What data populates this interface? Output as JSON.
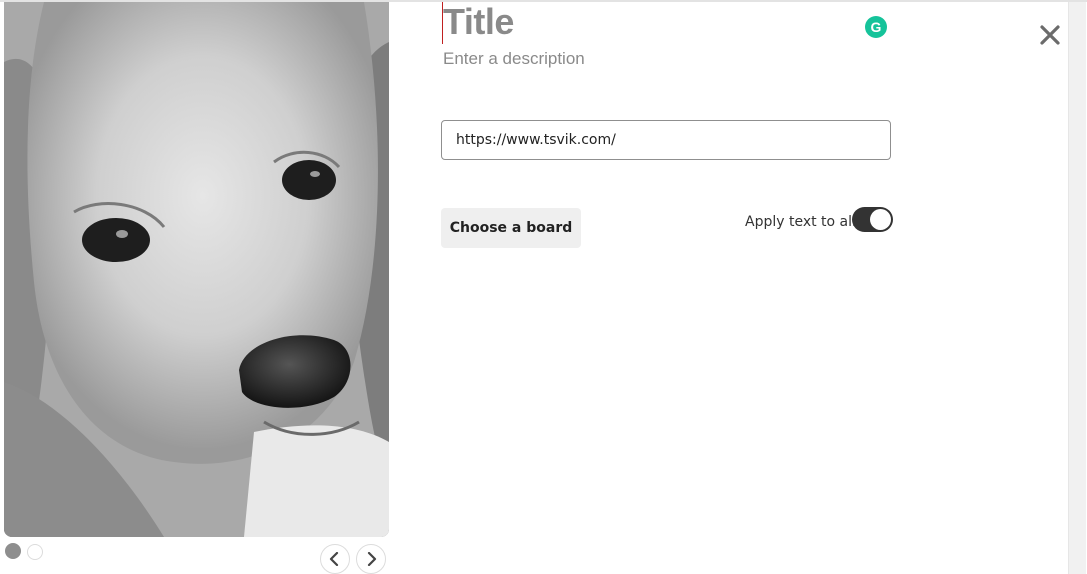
{
  "pin_form": {
    "title_placeholder": "Title",
    "description_placeholder": "Enter a description",
    "url_value": "https://www.tsvik.com/",
    "choose_board_label": "Choose a board",
    "apply_text_label": "Apply text to all",
    "apply_text_enabled": true
  },
  "image_carousel": {
    "image_subject": "pencil sketch of a puppy",
    "slide_count": 2,
    "active_slide": 1,
    "prev_icon": "chevron-left-icon",
    "next_icon": "chevron-right-icon"
  },
  "icons": {
    "close": "close-icon",
    "grammarly": "grammarly-icon"
  },
  "colors": {
    "grammarly": "#15c39a",
    "toggle_on": "#333333",
    "placeholder_text": "#8a8a8a"
  }
}
